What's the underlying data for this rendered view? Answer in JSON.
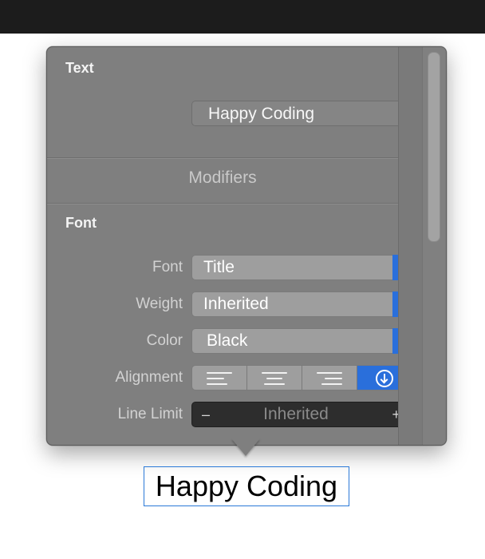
{
  "inspector": {
    "text_section": {
      "title": "Text",
      "value": "Happy Coding"
    },
    "modifiers_label": "Modifiers",
    "font_section": {
      "title": "Font",
      "rows": [
        {
          "label": "Font",
          "value": "Title"
        },
        {
          "label": "Weight",
          "value": "Inherited"
        },
        {
          "label": "Color",
          "value": "Black"
        }
      ],
      "alignment": {
        "label": "Alignment",
        "options": [
          "leading-align-icon",
          "center-align-icon",
          "trailing-align-icon",
          "down-arrow-circle-icon"
        ],
        "selected": 3
      },
      "line_limit": {
        "label": "Line Limit",
        "value": "Inherited",
        "decrement": "–",
        "increment": "+"
      }
    }
  },
  "canvas": {
    "preview_text": "Happy Coding"
  },
  "colors": {
    "accent": "#2a6fdb",
    "popover_bg": "#7f7f7f",
    "selection_border": "#2b79d8"
  }
}
